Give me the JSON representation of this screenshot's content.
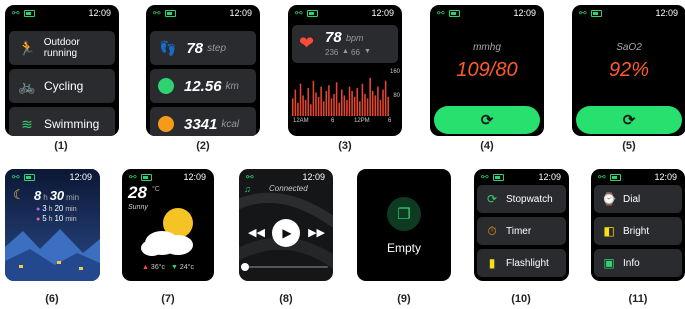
{
  "status": {
    "time": "12:09"
  },
  "labels": [
    "(1)",
    "(2)",
    "(3)",
    "(4)",
    "(5)",
    "(6)",
    "(7)",
    "(8)",
    "(9)",
    "(10)",
    "(11)"
  ],
  "screen1": {
    "items": [
      {
        "label": "Outdoor running",
        "icon": "running-icon",
        "color": "#2dd36f"
      },
      {
        "label": "Cycling",
        "icon": "cycling-icon",
        "color": "#2dd36f"
      },
      {
        "label": "Swimming",
        "icon": "swimming-icon",
        "color": "#2dd36f"
      }
    ]
  },
  "screen2": {
    "stats": [
      {
        "value": "78",
        "unit": "step",
        "icon": "footsteps-icon",
        "color": "#2dd36f"
      },
      {
        "value": "12.56",
        "unit": "km",
        "icon": "location-icon",
        "color": "#2dd36f"
      },
      {
        "value": "3341",
        "unit": "kcal",
        "icon": "flame-icon",
        "color": "#f59b1a"
      }
    ]
  },
  "screen3": {
    "bpm_value": "78",
    "bpm_unit": "bpm",
    "range_max": "236",
    "range_min": "66",
    "y_labels": [
      "160",
      "80"
    ],
    "x_labels": [
      "12AM",
      "6",
      "12PM",
      "6"
    ],
    "chart_data": {
      "type": "bar",
      "values": [
        60,
        90,
        45,
        110,
        70,
        55,
        95,
        40,
        120,
        80,
        65,
        100,
        50,
        85,
        105,
        60,
        75,
        115,
        45,
        90,
        70,
        55,
        100,
        85,
        65,
        95,
        50,
        110,
        75,
        60,
        130,
        85,
        70,
        100,
        55,
        90,
        120,
        65
      ],
      "ylim": [
        0,
        160
      ]
    }
  },
  "screen4": {
    "unit": "mmhg",
    "value": "109/80"
  },
  "screen5": {
    "unit": "SaO2",
    "value": "92%"
  },
  "screen6": {
    "total_h": "8",
    "total_m": "30",
    "h_unit": "h",
    "m_unit": "min",
    "deep_h": "3",
    "deep_m": "20",
    "light_h": "5",
    "light_m": "10"
  },
  "screen7": {
    "temp": "28",
    "deg": "°C",
    "condition": "Sunny",
    "low": "36°c",
    "high": "24°c"
  },
  "screen8": {
    "status": "Connected"
  },
  "screen9": {
    "label": "Empty"
  },
  "screen10": {
    "items": [
      {
        "label": "Stopwatch",
        "icon": "stopwatch-icon",
        "color": "#2dd36f"
      },
      {
        "label": "Timer",
        "icon": "timer-icon",
        "color": "#f59b1a"
      },
      {
        "label": "Flashlight",
        "icon": "flashlight-icon",
        "color": "#f5e01a"
      }
    ]
  },
  "screen11": {
    "items": [
      {
        "label": "Dial",
        "icon": "watch-dial-icon",
        "color": "#2dd36f"
      },
      {
        "label": "Bright",
        "icon": "brightness-icon",
        "color": "#f5e01a"
      },
      {
        "label": "Info",
        "icon": "info-icon",
        "color": "#2dd36f"
      }
    ]
  }
}
